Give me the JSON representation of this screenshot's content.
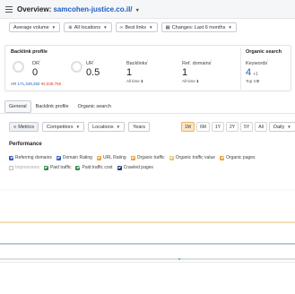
{
  "header": {
    "title_prefix": "Overview:",
    "domain": "samcohen-justice.co.il/"
  },
  "filters": {
    "volume": "Average volume",
    "locations": "All locations",
    "links": "Best links",
    "changes": "Changes: Last 6 months"
  },
  "backlink_profile": {
    "heading": "Backlink profile",
    "dr": {
      "label": "DR",
      "value": "0"
    },
    "ur": {
      "label": "UR",
      "value": "0.5"
    },
    "ar": {
      "label": "AR",
      "value": "171,349,282",
      "change": "▾2,039,756"
    },
    "backlinks": {
      "label": "Backlinks",
      "value": "1",
      "sub_label": "All time",
      "sub_value": "1"
    },
    "ref_domains": {
      "label": "Ref. domains",
      "value": "1",
      "sub_label": "All time",
      "sub_value": "1"
    }
  },
  "organic_search": {
    "heading": "Organic search",
    "keywords": {
      "label": "Keywords",
      "value": "4",
      "delta": "+1",
      "sub_label": "Top 3",
      "sub_value": "0"
    }
  },
  "tabs": [
    "General",
    "Backlink profile",
    "Organic search"
  ],
  "controls": {
    "metrics": "Metrics",
    "competitors": "Competitors",
    "locations": "Locations",
    "years": "Years",
    "ranges": [
      "1M",
      "6M",
      "1Y",
      "2Y",
      "5Y",
      "All"
    ],
    "selected_range": "1M",
    "interval": "Daily"
  },
  "performance": {
    "heading": "Performance",
    "legend_row1": [
      {
        "label": "Referring domains",
        "color": "#2f5fb8",
        "checked": true
      },
      {
        "label": "Domain Rating",
        "color": "#2f5fb8",
        "checked": true
      },
      {
        "label": "URL Rating",
        "color": "#e9a340",
        "checked": true
      },
      {
        "label": "Organic traffic",
        "color": "#e9a340",
        "checked": true
      },
      {
        "label": "Organic traffic value",
        "color": "#e9c070",
        "checked": true
      },
      {
        "label": "Organic pages",
        "color": "#e9a340",
        "checked": true
      }
    ],
    "legend_row2": [
      {
        "label": "Impressions",
        "color": "#bbbbbb",
        "checked": false
      },
      {
        "label": "Paid traffic",
        "color": "#2e8b57",
        "checked": true
      },
      {
        "label": "Paid traffic cost",
        "color": "#2e8b57",
        "checked": true
      },
      {
        "label": "Crawled pages",
        "color": "#1f3b70",
        "checked": true
      }
    ]
  }
}
